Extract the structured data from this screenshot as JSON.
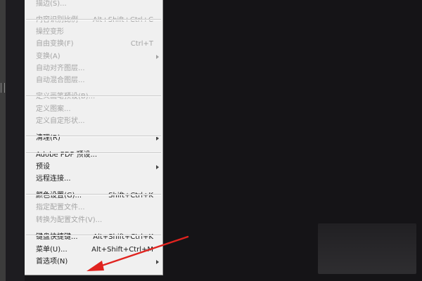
{
  "menu": {
    "items": [
      {
        "label": "描边(S)...",
        "shortcut": "",
        "enabled": false,
        "submenu": false
      },
      {
        "label": "内容识别比例",
        "shortcut": "Alt+Shift+Ctrl+C",
        "enabled": false,
        "submenu": false
      },
      {
        "label": "操控变形",
        "shortcut": "",
        "enabled": false,
        "submenu": false
      },
      {
        "label": "自由变换(F)",
        "shortcut": "Ctrl+T",
        "enabled": false,
        "submenu": false
      },
      {
        "label": "变换(A)",
        "shortcut": "",
        "enabled": false,
        "submenu": true
      },
      {
        "label": "自动对齐图层...",
        "shortcut": "",
        "enabled": false,
        "submenu": false
      },
      {
        "label": "自动混合图层...",
        "shortcut": "",
        "enabled": false,
        "submenu": false
      },
      {
        "label": "定义画笔预设(B)...",
        "shortcut": "",
        "enabled": false,
        "submenu": false
      },
      {
        "label": "定义图案...",
        "shortcut": "",
        "enabled": false,
        "submenu": false
      },
      {
        "label": "定义自定形状...",
        "shortcut": "",
        "enabled": false,
        "submenu": false
      },
      {
        "label": "清理(R)",
        "shortcut": "",
        "enabled": true,
        "submenu": true
      },
      {
        "label": "Adobe PDF 预设...",
        "shortcut": "",
        "enabled": true,
        "submenu": false
      },
      {
        "label": "预设",
        "shortcut": "",
        "enabled": true,
        "submenu": true
      },
      {
        "label": "远程连接...",
        "shortcut": "",
        "enabled": true,
        "submenu": false
      },
      {
        "label": "颜色设置(G)...",
        "shortcut": "Shift+Ctrl+K",
        "enabled": true,
        "submenu": false
      },
      {
        "label": "指定配置文件...",
        "shortcut": "",
        "enabled": false,
        "submenu": false
      },
      {
        "label": "转换为配置文件(V)...",
        "shortcut": "",
        "enabled": false,
        "submenu": false
      },
      {
        "label": "键盘快捷键...",
        "shortcut": "Alt+Shift+Ctrl+K",
        "enabled": true,
        "submenu": false
      },
      {
        "label": "菜单(U)...",
        "shortcut": "Alt+Shift+Ctrl+M",
        "enabled": true,
        "submenu": false
      },
      {
        "label": "首选项(N)",
        "shortcut": "",
        "enabled": true,
        "submenu": true
      }
    ]
  },
  "colors": {
    "menu_background": "#f0f0f0",
    "text_enabled": "#1a1a1a",
    "text_disabled": "#a5a5a5",
    "workspace": "#151417",
    "annotation_arrow": "#e0231f"
  }
}
